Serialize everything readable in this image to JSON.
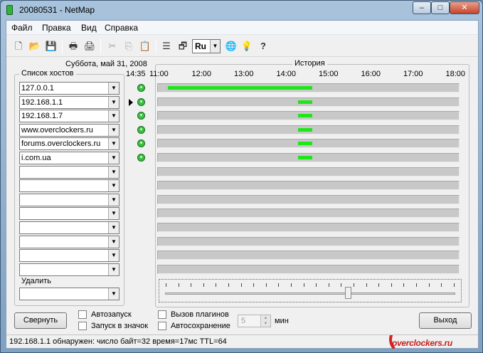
{
  "window": {
    "title": "20080531 - NetMap",
    "min": "–",
    "max": "□",
    "close": "✕"
  },
  "menu": [
    "Файл",
    "Правка",
    "Вид",
    "Справка"
  ],
  "toolbar": {
    "language": "Ru"
  },
  "date": "Суббота, май 31, 2008",
  "hosts": {
    "title": "Список хостов",
    "items": [
      "127.0.0.1",
      "192.168.1.1",
      "192.168.1.7",
      "www.overclockers.ru",
      "forums.overclockers.ru",
      "i.com.ua",
      "",
      "",
      "",
      "",
      "",
      "",
      "",
      ""
    ],
    "selected_row": 1
  },
  "delete": {
    "label": "Удалить",
    "value": ""
  },
  "history": {
    "title": "История",
    "current_time": "14:35",
    "times": [
      "11:00",
      "12:00",
      "13:00",
      "14:00",
      "15:00",
      "16:00",
      "17:00",
      "18:00"
    ],
    "activity": [
      {
        "start": "11:10",
        "end": "14:35"
      },
      {
        "start": "14:15",
        "end": "14:35"
      },
      {
        "start": "14:15",
        "end": "14:35"
      },
      {
        "start": "14:15",
        "end": "14:35"
      },
      {
        "start": "14:15",
        "end": "14:35"
      },
      {
        "start": "14:15",
        "end": "14:35"
      }
    ],
    "zoom_level": 0.63
  },
  "buttons": {
    "collapse": "Свернуть",
    "exit": "Выход"
  },
  "options": {
    "autostart": "Автозапуск",
    "tray_start": "Запуск в значок",
    "plugins": "Вызов плагинов",
    "autosave": "Автосохранение",
    "autosave_interval": "5",
    "interval_unit": "мин"
  },
  "status": "192.168.1.1 обнаружен: число байт=32 время=17мс TTL=64",
  "watermark": "overclockers.ru",
  "colors": {
    "online": "#3cc241",
    "activity": "#1ee61a",
    "track": "#c8c8c8"
  }
}
